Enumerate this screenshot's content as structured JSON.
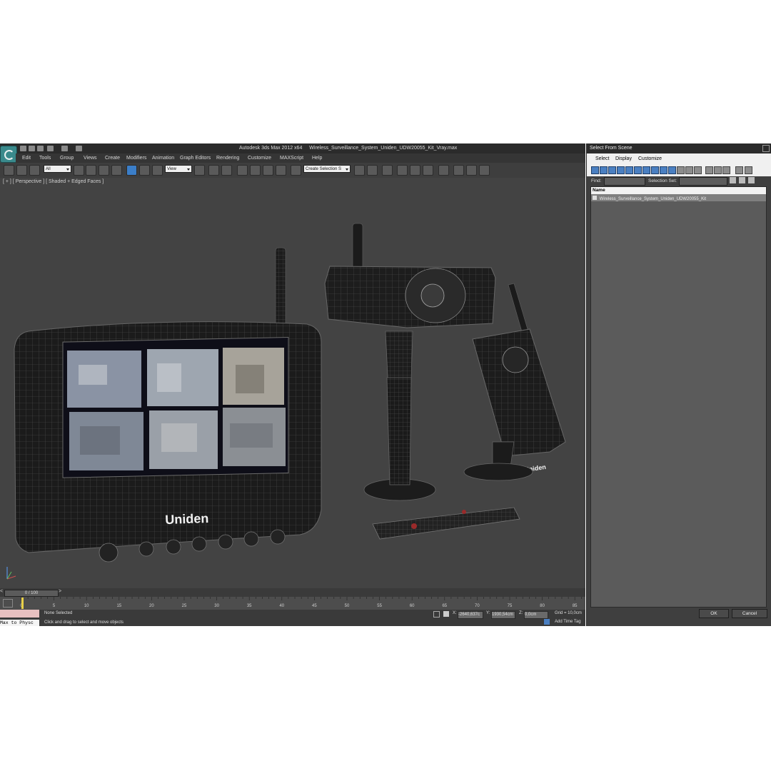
{
  "app": {
    "title_app": "Autodesk 3ds Max  2012 x64",
    "title_file": "Wireless_Surveillance_System_Uniden_UDW20055_Kit_Vray.max"
  },
  "menu": [
    "Edit",
    "Tools",
    "Group",
    "Views",
    "Create",
    "Modifiers",
    "Animation",
    "Graph Editors",
    "Rendering",
    "Customize",
    "MAXScript",
    "Help"
  ],
  "toolbar": {
    "filter_value": "All",
    "refcoord_value": "View",
    "selection_set_placeholder": "Create Selection S"
  },
  "viewport": {
    "label": "[ + ] [ Perspective ] [ Shaded + Edged Faces ]",
    "monitor_brand": "Uniden",
    "receiver_brand": "Uniden"
  },
  "timeline": {
    "frame_readout": "0 / 100",
    "ticks": [
      "0",
      "5",
      "10",
      "15",
      "20",
      "25",
      "30",
      "35",
      "40",
      "45",
      "50",
      "55",
      "60",
      "65",
      "70",
      "75",
      "80",
      "85"
    ]
  },
  "status": {
    "selection": "None Selected",
    "prompt": "Click and drag to select and move objects",
    "maxscript_listener": "Max to Physc",
    "x_label": "X:",
    "x_value": "-2640,637c",
    "y_label": "Y:",
    "y_value": "1930,54cm",
    "z_label": "Z:",
    "z_value": "0,0cm",
    "grid": "Grid = 10,0cm",
    "add_time_tag": "Add Time Tag"
  },
  "panel": {
    "title": "Select From Scene",
    "menu": [
      "Select",
      "Display",
      "Customize"
    ],
    "find_label": "Find:",
    "selection_set_label": "Selection Set:",
    "column_name": "Name",
    "items": [
      "Wireless_Surveillance_System_Uniden_UDW20055_Kit"
    ],
    "ok_label": "OK",
    "cancel_label": "Cancel"
  },
  "colors": {
    "viewport_bg": "#434343",
    "ui_dark": "#3a3a3a",
    "accent_blue": "#3b7ec8"
  }
}
